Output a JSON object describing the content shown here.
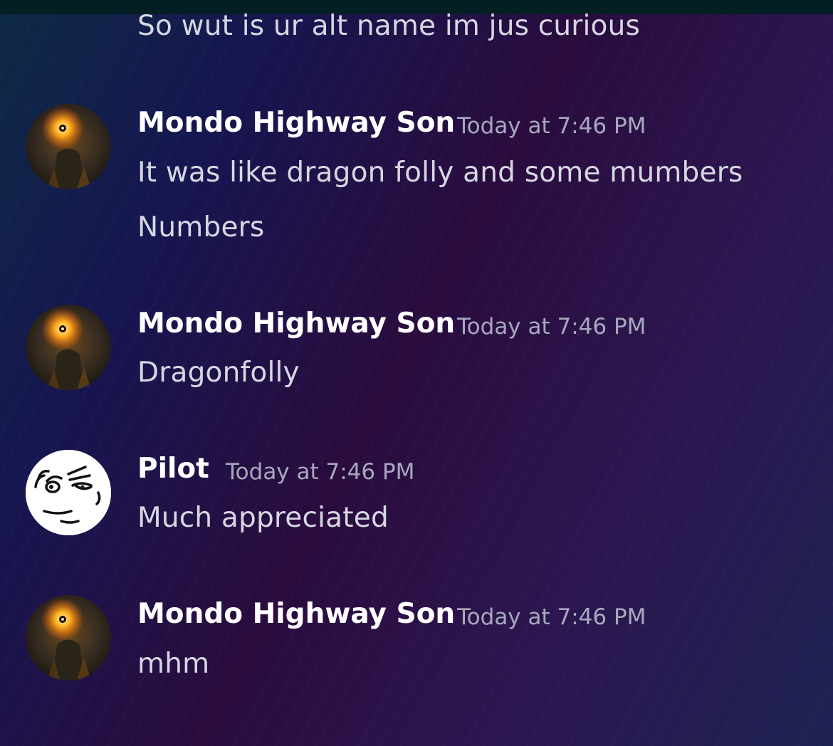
{
  "chat": {
    "prev_message": "So wut is ur alt name im jus curious",
    "messages": [
      {
        "author": "Mondo Highway Son",
        "timestamp": "Today at 7:46 PM",
        "avatar_icon": "burning-lord-avatar",
        "lines": [
          "It was like dragon folly and some mumbers",
          "Numbers"
        ]
      },
      {
        "author": "Mondo Highway Son",
        "timestamp": "Today at 7:46 PM",
        "avatar_icon": "burning-lord-avatar",
        "lines": [
          "Dragonfolly"
        ]
      },
      {
        "author": "Pilot",
        "timestamp": "Today at 7:46 PM",
        "avatar_icon": "meme-face-avatar",
        "lines": [
          "Much appreciated"
        ]
      },
      {
        "author": "Mondo Highway Son",
        "timestamp": "Today at 7:46 PM",
        "avatar_icon": "burning-lord-avatar",
        "lines": [
          "mhm"
        ]
      }
    ]
  },
  "colors": {
    "author": "#ffffff",
    "message_text": "#d6d7e2",
    "timestamp": "#a7a8bd",
    "top_bar": "#041f24"
  }
}
